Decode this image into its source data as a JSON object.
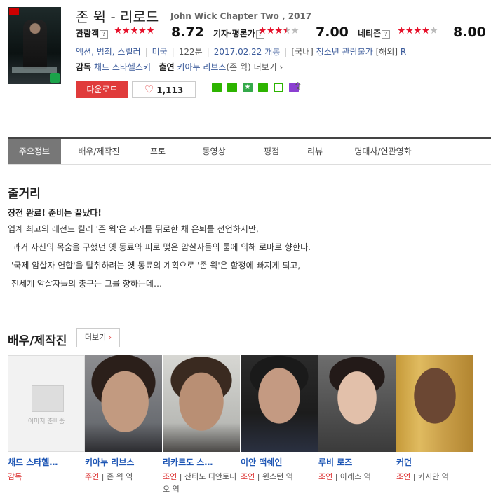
{
  "movie": {
    "title": "존 윅 - 리로드",
    "original_title": "John Wick Chapter Two , 2017"
  },
  "ratings": [
    {
      "label": "관람객",
      "score": "8.72",
      "stars": 4.4
    },
    {
      "label": "기자·평론가",
      "score": "7.00",
      "stars": 3.5
    },
    {
      "label": "네티즌",
      "score": "8.00",
      "stars": 4.0
    }
  ],
  "meta": {
    "genre": "액션, 범죄, 스릴러",
    "country": "미국",
    "runtime": "122분",
    "release": "2017.02.22 개봉",
    "domestic_label": "[국내]",
    "domestic_rating": "청소년 관람불가",
    "overseas_label": "[해외]",
    "overseas_rating": "R"
  },
  "credits": {
    "director_label": "감독",
    "director": "채드 스타헬스키",
    "cast_label": "출연",
    "cast": "키아누 리브스",
    "cast_role": "(존 윅)",
    "more": "더보기"
  },
  "actions": {
    "download": "다운로드",
    "likes": "1,113"
  },
  "share_colors": [
    "#2db400",
    "#2db400",
    "#34a94a",
    "#2db400",
    "#8b3fd1",
    "#777777"
  ],
  "tabs": [
    "주요정보",
    "배우/제작진",
    "포토",
    "동영상",
    "평점",
    "리뷰",
    "명대사/연관영화"
  ],
  "synopsis": {
    "heading": "줄거리",
    "lead": "장전 완료! 준비는 끝났다!",
    "lines": [
      "업계 최고의 레전드 킬러 '존 윅'은 과거를 뒤로한 채 은퇴를 선언하지만,",
      "과거 자신의 목숨을 구했던 옛 동료와 피로 맺은 암살자들의 룰에 의해 로마로 향한다.",
      "'국제 암살자 연합'을 탈취하려는 옛 동료의 계획으로 '존 윅'은 함정에 빠지게 되고,",
      "전세계 암살자들의 총구는 그를 향하는데…"
    ]
  },
  "cast_section": {
    "heading": "배우/제작진",
    "more": "더보기",
    "no_image": "이미지 준비중",
    "people": [
      {
        "name": "채드 스타헬…",
        "role": "감독",
        "character": ""
      },
      {
        "name": "키아누 리브스",
        "role": "주연",
        "character": "존 윅 역"
      },
      {
        "name": "리카르도 스…",
        "role": "조연",
        "character": "산티노 디안토니오 역"
      },
      {
        "name": "이안 맥쉐인",
        "role": "조연",
        "character": "윈스턴 역"
      },
      {
        "name": "루비 로즈",
        "role": "조연",
        "character": "아레스 역"
      },
      {
        "name": "커먼",
        "role": "조연",
        "character": "카시안 역"
      }
    ]
  },
  "colors": {
    "accent_red": "#e03b3b",
    "link_blue": "#1f57b5",
    "star_red": "#e6112a"
  }
}
